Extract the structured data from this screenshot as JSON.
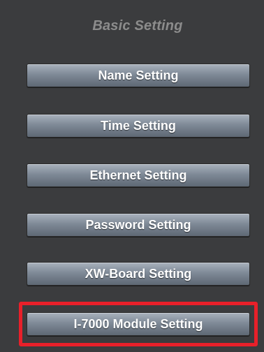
{
  "panel": {
    "title": "Basic Setting"
  },
  "buttons": [
    {
      "label": "Name Setting"
    },
    {
      "label": "Time Setting"
    },
    {
      "label": "Ethernet Setting"
    },
    {
      "label": "Password Setting"
    },
    {
      "label": "XW-Board Setting"
    },
    {
      "label": "I-7000 Module Setting"
    }
  ],
  "highlight": {
    "color": "#e8202a",
    "target": "I-7000 Module Setting"
  }
}
